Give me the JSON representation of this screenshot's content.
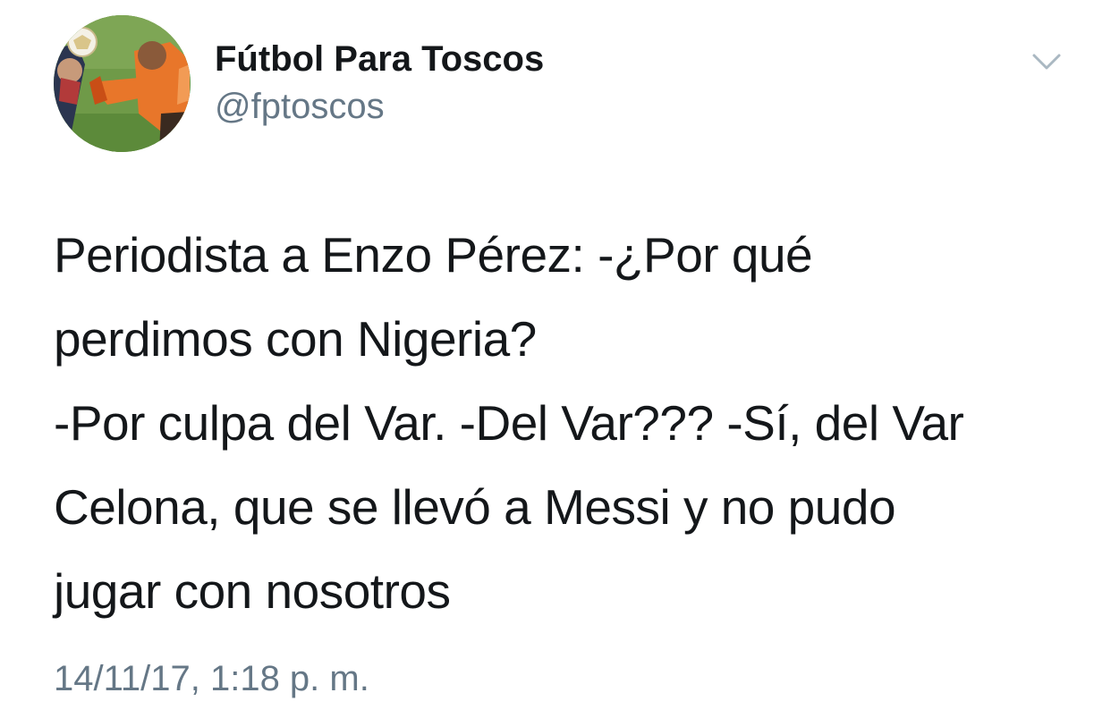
{
  "author": {
    "display_name": "Fútbol Para Toscos",
    "handle": "@fptoscos",
    "avatar_icon": "soccer-player-avatar"
  },
  "menu": {
    "icon": "chevron-down-icon"
  },
  "tweet": {
    "lines": [
      "Periodista a Enzo Pérez: -¿Por qué",
      "perdimos con Nigeria?",
      "-Por culpa del Var. -Del Var??? -Sí, del Var",
      "Celona, que se llevó a Messi y no pudo",
      "jugar con nosotros"
    ],
    "timestamp": "14/11/17, 1:18 p. m."
  },
  "colors": {
    "text": "#14171a",
    "secondary_text": "#657786",
    "caret": "#aab8c2"
  }
}
